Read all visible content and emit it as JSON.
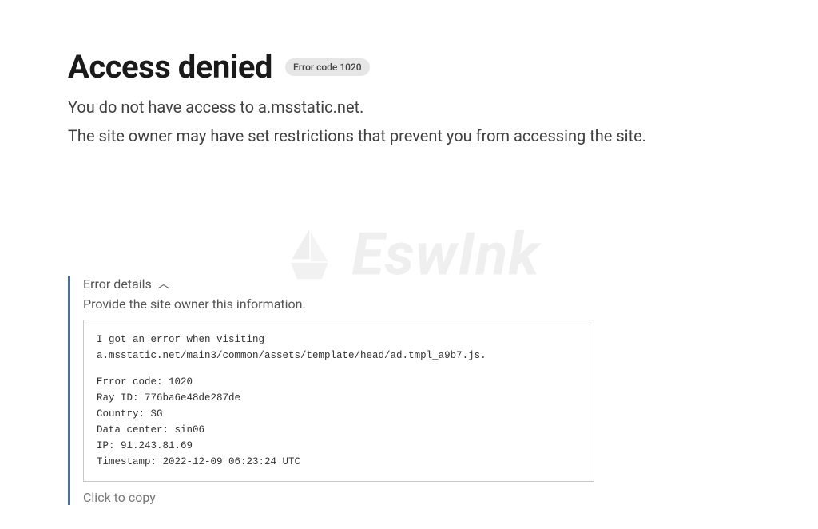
{
  "header": {
    "title": "Access denied",
    "error_badge": "Error code 1020"
  },
  "description": {
    "line1": "You do not have access to a.msstatic.net.",
    "line2": "The site owner may have set restrictions that prevent you from accessing the site."
  },
  "watermark": {
    "text": "EswInk"
  },
  "details": {
    "header_label": "Error details",
    "instruction": "Provide the site owner this information.",
    "url_line": "I got an error when visiting a.msstatic.net/main3/common/assets/template/head/ad.tmpl_a9b7.js.",
    "error_code_line": "Error code: 1020",
    "ray_id_line": "Ray ID: 776ba6e48de287de",
    "country_line": "Country: SG",
    "data_center_line": "Data center: sin06",
    "ip_line": "IP: 91.243.81.69",
    "timestamp_line": "Timestamp: 2022-12-09 06:23:24 UTC",
    "copy_label": "Click to copy"
  }
}
